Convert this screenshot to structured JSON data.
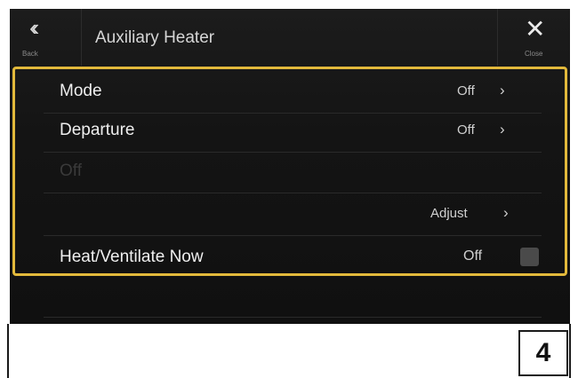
{
  "header": {
    "back_label": "Back",
    "back_icon": "double-chevron-left",
    "title": "Auxiliary Heater",
    "close_label": "Close",
    "close_icon": "x"
  },
  "rows": [
    {
      "label": "Mode",
      "value": "Off"
    },
    {
      "label": "Departure",
      "value": "Off"
    },
    {
      "label": "Off"
    },
    {
      "label": "",
      "value": "Adjust"
    },
    {
      "label": "Heat/Ventilate Now",
      "value": "Off",
      "checked": false
    }
  ],
  "page_number": "4",
  "colors": {
    "highlight": "#e2b93b",
    "background": "#141414"
  }
}
